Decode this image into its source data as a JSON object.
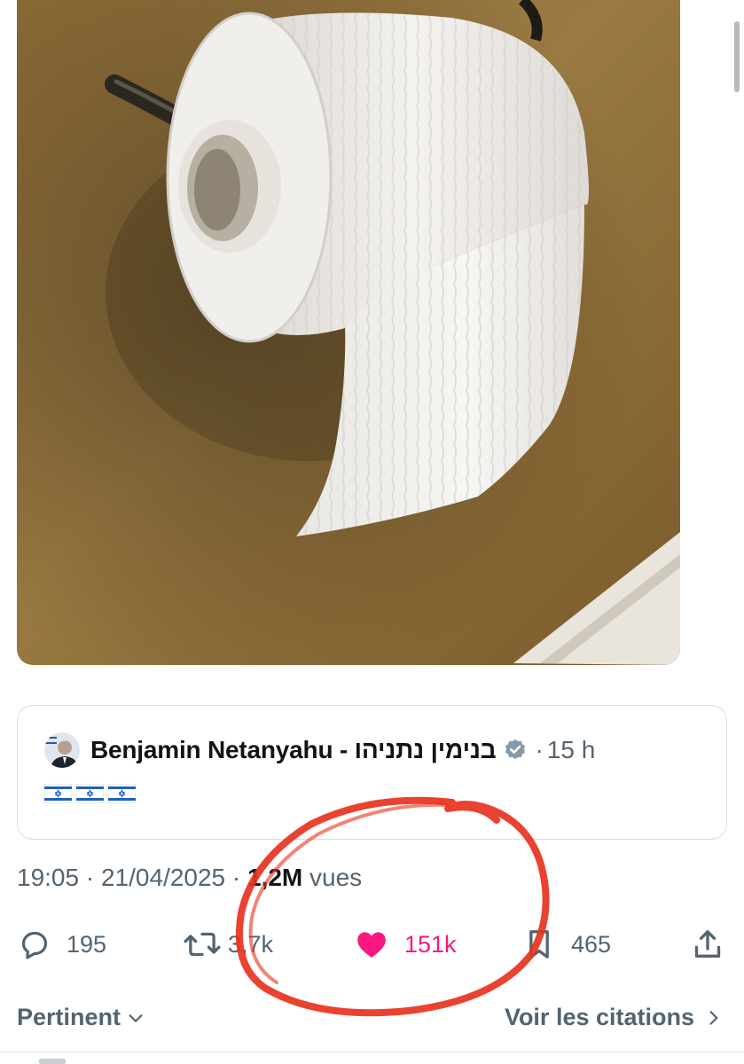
{
  "quoted_tweet": {
    "author_name": "Benjamin Netanyahu - בנימין נתניהו",
    "time_ago": "15 h",
    "separator": "·",
    "flags": [
      "israel-flag",
      "israel-flag",
      "israel-flag"
    ]
  },
  "tweet_meta": {
    "time": "19:05",
    "date": "21/04/2025",
    "views_count": "1,2M",
    "views_label": "vues",
    "separator": "·"
  },
  "actions": {
    "replies": "195",
    "reposts": "3,7k",
    "likes": "151k",
    "bookmarks": "465"
  },
  "bottom_bar": {
    "sort_label": "Pertinent",
    "quotes_label": "Voir les citations"
  },
  "icons": {
    "reply": "comment-icon",
    "repost": "repost-icon",
    "like": "heart-icon",
    "bookmark": "bookmark-icon",
    "share": "share-icon",
    "verified": "verified-badge-icon"
  },
  "colors": {
    "like_accent": "#f91880",
    "annotation": "#e8321e",
    "muted_text": "#536471"
  }
}
